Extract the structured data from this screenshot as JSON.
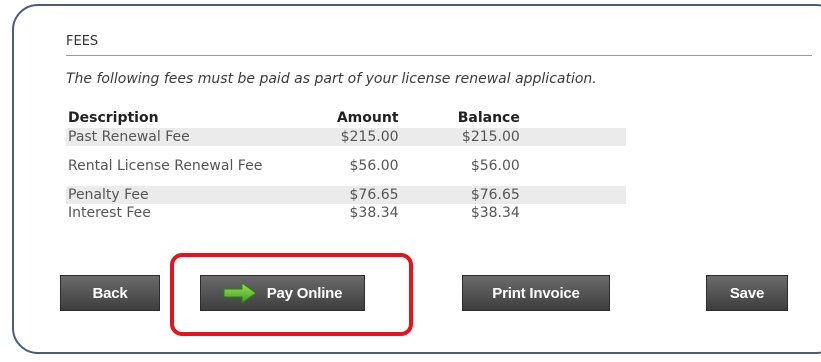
{
  "section": {
    "title": "FEES",
    "intro": "The following fees must be paid as part of your license renewal application."
  },
  "table": {
    "headers": {
      "description": "Description",
      "amount": "Amount",
      "balance": "Balance"
    },
    "rows": [
      {
        "description": "Past Renewal Fee",
        "amount": "$215.00",
        "balance": "$215.00"
      },
      {
        "description": "Rental License Renewal Fee",
        "amount": "$56.00",
        "balance": "$56.00"
      },
      {
        "description": "Penalty Fee",
        "amount": "$76.65",
        "balance": "$76.65"
      },
      {
        "description": "Interest Fee",
        "amount": "$38.34",
        "balance": "$38.34"
      }
    ]
  },
  "buttons": {
    "back": "Back",
    "pay_online": "Pay Online",
    "print_invoice": "Print Invoice",
    "save": "Save"
  },
  "icons": {
    "pay_online": "right-arrow-icon"
  },
  "colors": {
    "frame_border": "#4a5e78",
    "button_bg": "#4f4f4f",
    "highlight": "#e3141b",
    "arrow": "#5bbf2a"
  }
}
